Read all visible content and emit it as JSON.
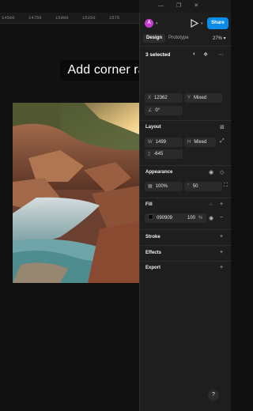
{
  "window": {
    "controls": [
      "—",
      "❐",
      "✕"
    ]
  },
  "ruler": {
    "ticks": [
      "14500",
      "14750",
      "15000",
      "15250",
      "1575"
    ]
  },
  "canvas": {
    "hint": "Add corner radius"
  },
  "header": {
    "avatar_initial": "A",
    "share_label": "Share"
  },
  "tabs": {
    "design": "Design",
    "prototype": "Prototype",
    "zoom": "27%"
  },
  "selection": {
    "label": "3 selected"
  },
  "position": {
    "x_label": "X",
    "x_value": "12362",
    "y_label": "Y",
    "y_value": "Mixed",
    "rotation_value": "0°"
  },
  "layout": {
    "title": "Layout",
    "w_label": "W",
    "w_value": "1499",
    "h_label": "H",
    "h_value": "Mixed",
    "extra_value": "-645"
  },
  "appearance": {
    "title": "Appearance",
    "opacity_value": "100%",
    "radius_value": "50"
  },
  "fill": {
    "title": "Fill",
    "hex": "090909",
    "opacity": "100",
    "unit": "%",
    "swatch_color": "#090909"
  },
  "sections": {
    "stroke": "Stroke",
    "effects": "Effects",
    "export": "Export"
  },
  "help": "?",
  "colors": {
    "accent": "#0c8ce9",
    "panel_bg": "#1e1e1e",
    "avatar": "#c83bd2"
  }
}
